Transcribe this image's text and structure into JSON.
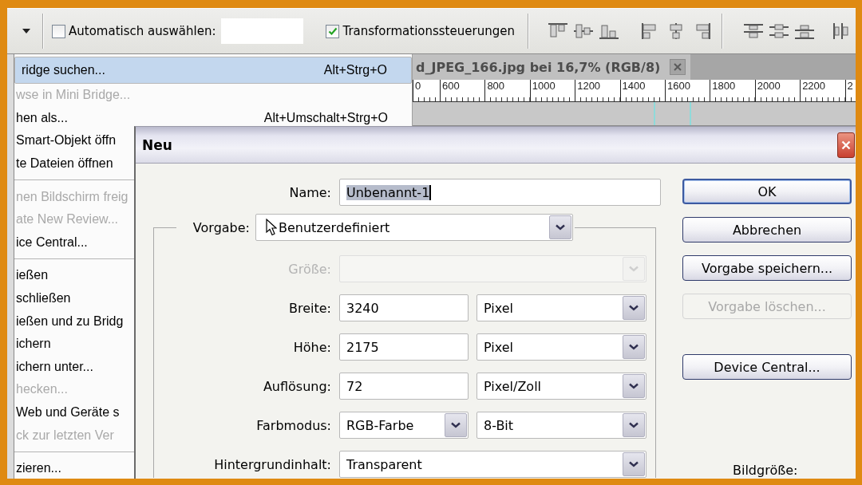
{
  "toolbar": {
    "auto_select": {
      "label": "Automatisch auswählen:",
      "checked": false
    },
    "transform_controls": {
      "label": "Transformationssteuerungen",
      "checked": true
    }
  },
  "menu": {
    "items": [
      {
        "kind": "item",
        "label": "ridge suchen...",
        "shortcut": "Alt+Strg+O",
        "disabled": false,
        "selected": true
      },
      {
        "kind": "item",
        "label": "wse in Mini Bridge...",
        "disabled": true,
        "selected": false
      },
      {
        "kind": "item",
        "label": "hen als...",
        "shortcut": "Alt+Umschalt+Strg+O",
        "disabled": false,
        "selected": false
      },
      {
        "kind": "item",
        "label": "Smart-Objekt öffn",
        "disabled": false,
        "selected": false
      },
      {
        "kind": "item",
        "label": "te Dateien öffnen",
        "disabled": false,
        "selected": false
      },
      {
        "kind": "separator"
      },
      {
        "kind": "item",
        "label": "nen Bildschirm freig",
        "disabled": true,
        "selected": false
      },
      {
        "kind": "item",
        "label": "ate New Review...",
        "disabled": true,
        "selected": false
      },
      {
        "kind": "item",
        "label": "ice Central...",
        "disabled": false,
        "selected": false
      },
      {
        "kind": "separator"
      },
      {
        "kind": "item",
        "label": "ießen",
        "disabled": false,
        "selected": false
      },
      {
        "kind": "item",
        "label": "schließen",
        "disabled": false,
        "selected": false
      },
      {
        "kind": "item",
        "label": "ießen und zu Bridg",
        "disabled": false,
        "selected": false
      },
      {
        "kind": "item",
        "label": "ichern",
        "disabled": false,
        "selected": false
      },
      {
        "kind": "item",
        "label": "ichern unter...",
        "disabled": false,
        "selected": false
      },
      {
        "kind": "item",
        "label": "hecken...",
        "disabled": true,
        "selected": false
      },
      {
        "kind": "item",
        "label": "Web und Geräte s",
        "disabled": false,
        "selected": false
      },
      {
        "kind": "item",
        "label": "ck zur letzten Ver",
        "disabled": true,
        "selected": false
      },
      {
        "kind": "separator"
      },
      {
        "kind": "item",
        "label": "zieren...",
        "disabled": false,
        "selected": false
      }
    ]
  },
  "document": {
    "tab": {
      "title": "d_JPEG_166.jpg bei 16,7% (RGB/8)",
      "selected": true
    },
    "ruler_labels": [
      "0",
      "600",
      "800",
      "1000",
      "1200",
      "1400",
      "1600",
      "1800",
      "2000",
      "2200",
      "2"
    ]
  },
  "dialog": {
    "title": "Neu",
    "name": {
      "label": "Name:",
      "value": "Unbenannt-1",
      "text_selected": true
    },
    "preset": {
      "label": "Vorgabe:",
      "value": "Benutzerdefiniert"
    },
    "rows": [
      {
        "label": "Größe:",
        "disabled": true,
        "controls": [
          {
            "kind": "select"
          }
        ]
      },
      {
        "label": "Breite:",
        "disabled": false,
        "controls": [
          {
            "kind": "input",
            "value": "3240"
          },
          {
            "kind": "select",
            "value": "Pixel"
          }
        ]
      },
      {
        "label": "Höhe:",
        "disabled": false,
        "controls": [
          {
            "kind": "input",
            "value": "2175"
          },
          {
            "kind": "select",
            "value": "Pixel"
          }
        ]
      },
      {
        "label": "Auflösung:",
        "disabled": false,
        "controls": [
          {
            "kind": "input",
            "value": "72"
          },
          {
            "kind": "select",
            "value": "Pixel/Zoll"
          }
        ]
      },
      {
        "label": "Farbmodus:",
        "disabled": false,
        "controls": [
          {
            "kind": "select",
            "value": "RGB-Farbe"
          },
          {
            "kind": "select",
            "value": "8-Bit"
          }
        ]
      },
      {
        "label": "Hintergrundinhalt:",
        "disabled": false,
        "controls": [
          {
            "kind": "select",
            "value": "Transparent"
          }
        ]
      }
    ],
    "buttons": [
      {
        "label": "OK",
        "default": true,
        "disabled": false
      },
      {
        "label": "Abbrechen",
        "default": false,
        "disabled": false
      },
      {
        "label": "Vorgabe speichern...",
        "default": false,
        "disabled": false
      },
      {
        "label": "Vorgabe löschen...",
        "default": false,
        "disabled": true
      }
    ],
    "extra_buttons": [
      {
        "label": "Device Central...",
        "default": false,
        "disabled": false
      }
    ],
    "image_size_label": "Bildgröße:"
  }
}
